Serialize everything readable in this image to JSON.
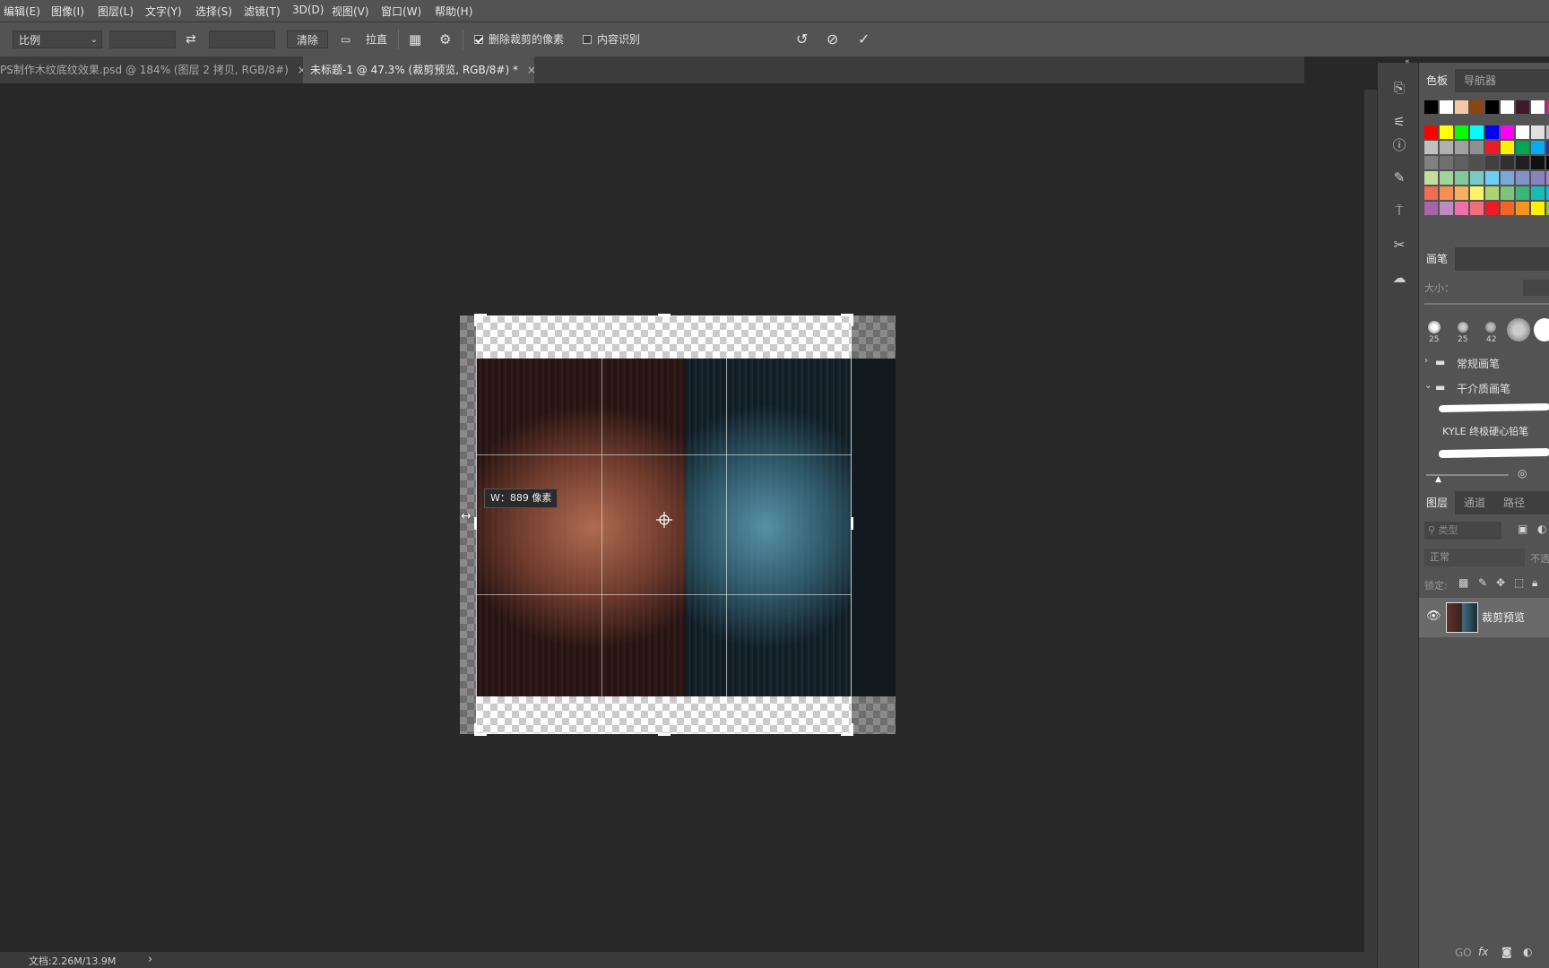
{
  "menu": [
    "编辑(E)",
    "图像(I)",
    "图层(L)",
    "文字(Y)",
    "选择(S)",
    "滤镜(T)",
    "3D(D)",
    "视图(V)",
    "窗口(W)",
    "帮助(H)"
  ],
  "options": {
    "ratio_value": "比例",
    "clear_label": "清除",
    "straighten_label": "拉直",
    "delete_cropped_label": "删除裁剪的像素",
    "delete_cropped_checked": true,
    "content_aware_label": "内容识别",
    "content_aware_checked": false
  },
  "tabs": [
    {
      "label": "PS制作木纹底纹效果.psd @ 184% (图层 2 拷贝, RGB/8#)",
      "close": "×",
      "active": false
    },
    {
      "label": "未标题-1 @ 47.3% (裁剪预览, RGB/8#) *",
      "close": "×",
      "active": true
    }
  ],
  "canvas": {
    "crop_tooltip": "W：889 像素"
  },
  "status": {
    "doc_info": "文档:2.26M/13.9M",
    "arrow": "›"
  },
  "right_panel": {
    "swatch_tabs": [
      "色板",
      "导航器"
    ],
    "swatches_row1": [
      "#000000",
      "#ffffff",
      "#f5c9a5",
      "#8b4513",
      "#000000",
      "#ffffff",
      "#3d1a2a",
      "#ffffff",
      "#d4237a"
    ],
    "swatches": [
      [
        "#ff0000",
        "#ffff00",
        "#00ff00",
        "#00ffff",
        "#0000ff",
        "#ff00ff",
        "#ffffff",
        "#e0e0e0",
        "#c0c0c0"
      ],
      [
        "#c0c0c0",
        "#b0b0b0",
        "#a0a0a0",
        "#909090",
        "#ed1c24",
        "#fff200",
        "#00a651",
        "#00aeef",
        "#2e3192"
      ],
      [
        "#808080",
        "#707070",
        "#606060",
        "#505050",
        "#404040",
        "#303030",
        "#202020",
        "#101010",
        "#000000"
      ],
      [
        "#c4df9b",
        "#a3d39c",
        "#82ca9c",
        "#7accc8",
        "#6dcff6",
        "#7ea7d8",
        "#8393ca",
        "#8882be",
        "#a187be"
      ],
      [
        "#f26c4f",
        "#f68e55",
        "#fbaf5c",
        "#fff467",
        "#acd372",
        "#7cc576",
        "#3bb878",
        "#1abbb4",
        "#00bff3"
      ],
      [
        "#a864a8",
        "#bd8cbf",
        "#f06eaa",
        "#f26d7d",
        "#ed1c24",
        "#f26522",
        "#f7941d",
        "#fff200",
        "#8dc63f"
      ]
    ],
    "brush_tab": "画笔",
    "size_label": "大小：",
    "brush_sizes": [
      "25",
      "25",
      "42"
    ],
    "group1": "常规画笔",
    "group2": "干介质画笔",
    "brush_name": "KYLE 终极硬心铅笔",
    "layer_tabs": [
      "图层",
      "通道",
      "路径"
    ],
    "kind_placeholder": "类型",
    "blend_mode": "正常",
    "opacity_label": "不透",
    "lock_label": "锁定:",
    "layer_name": "裁剪预览",
    "bottom_icons": [
      "GO",
      "fx"
    ]
  }
}
